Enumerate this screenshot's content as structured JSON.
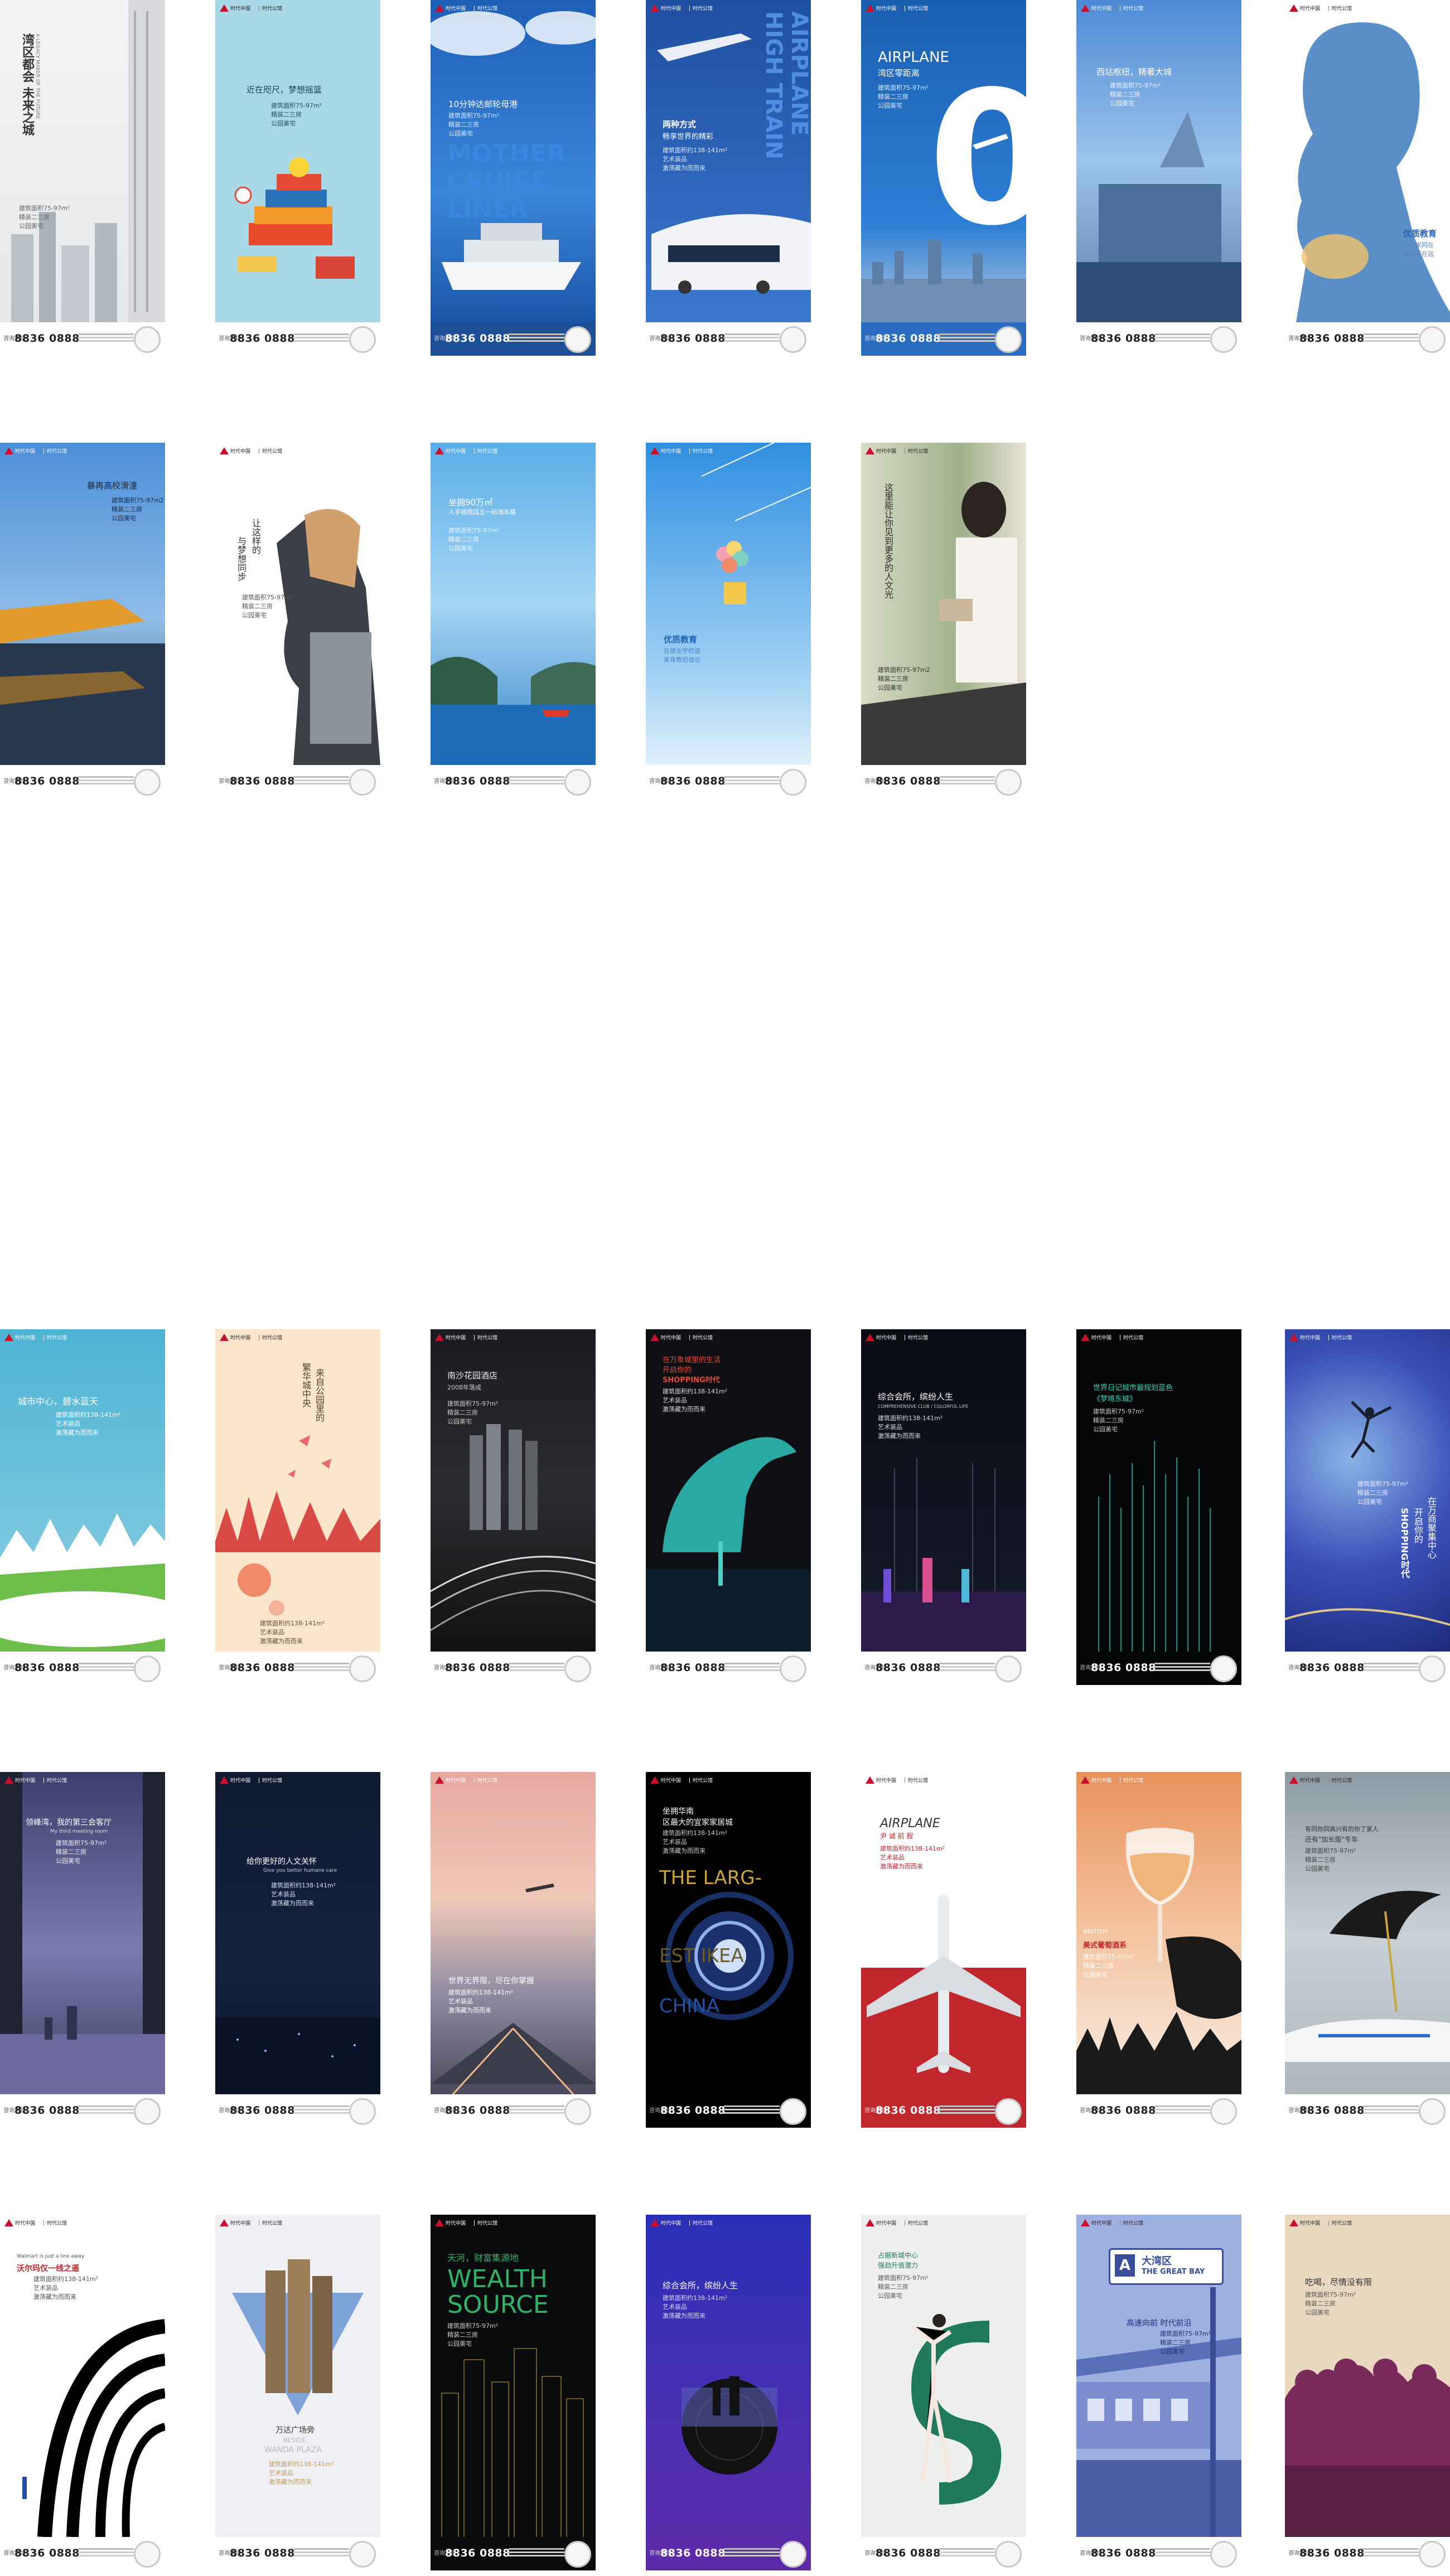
{
  "footer": {
    "phone_label": "咨询热线",
    "phone": "8836 0888"
  },
  "brand": {
    "name": "时代中国",
    "sub": "时代公馆"
  },
  "posters": [
    {
      "headline": "湾区都会 未来之城",
      "sub": "A LEGACY MAKER OF THE FUTURE",
      "lines": [
        "建筑面积75-97m²",
        "精装二三房",
        "公园美宅"
      ]
    },
    {
      "headline": "近在咫尺，梦想摇篮",
      "lines": [
        "建筑面积75-97m²",
        "精装二三房",
        "公园美宅"
      ]
    },
    {
      "headline": "10分钟达邮轮母港",
      "big": [
        "MOTHER",
        "CRUISE",
        "LINER"
      ],
      "lines": [
        "建筑面积75-97m²",
        "精装二三房",
        "公园美宅"
      ]
    },
    {
      "headline": "两种方式",
      "headline2": "畅享世界的精彩",
      "big": [
        "AIRPLANE",
        "HIGH TRAIN"
      ],
      "lines": [
        "建筑面积约138-141m²",
        "艺术装品",
        "激荡藏为而而来"
      ]
    },
    {
      "headline": "湾区零距离",
      "big": [
        "AIRPLANE",
        "0"
      ],
      "lines": [
        "建筑面积75-97m²",
        "精装二三房",
        "公园美宅"
      ]
    },
    {
      "headline": "西站枢纽，精著大城",
      "lines": [
        "建筑面积75-97m²",
        "精装二三房",
        "公园美宅"
      ]
    },
    {
      "headline": "优质教育",
      "lines": [
        "与众家同在",
        "教坊不在远"
      ]
    },
    {
      "headline": "暴再高校滑潼",
      "lines": [
        "建筑面积75-97m2",
        "精装二三房",
        "公园美宅"
      ]
    },
    {
      "headline": "与梦想同步",
      "headline2": "让这样的",
      "lines": [
        "建筑面积75-97m²",
        "精装二三房",
        "公园美宅"
      ]
    },
    {
      "headline": "坐拥90万㎡",
      "headline2": "人手插用园五一码海车路",
      "lines": [
        "建筑面积75-97m²",
        "精装二三房",
        "公园美宅"
      ]
    },
    {
      "headline": "优质教育",
      "lines": [
        "在建全学校道",
        "美育教观值也"
      ]
    },
    {
      "headline": "这里能让你见到更多的人文光",
      "lines": [
        "建筑面积75-97m2",
        "精装二三房",
        "公园美宅"
      ]
    },
    {
      "headline": "城市中心，碧水蓝天",
      "lines": [
        "建筑面积约138-141m²",
        "艺术装品",
        "激荡藏为而而来"
      ]
    },
    {
      "headline": "繁华城中央",
      "headline2": "来自公园里的",
      "lines": [
        "建筑面积约138-141m²",
        "艺术装品",
        "激荡藏为而而来"
      ]
    },
    {
      "headline": "南沙花园酒店",
      "sub": "2008年落成",
      "lines": [
        "建筑面积75-97m²",
        "精装二三房",
        "公园美宅"
      ]
    },
    {
      "headline": "在万象城里的生活",
      "headline2": "开启你的",
      "sub": "SHOPPING时代",
      "lines": [
        "建筑面积约138-141m²",
        "艺术装品",
        "激荡藏为而而来"
      ]
    },
    {
      "headline": "综合会所，缤纷人生",
      "sub": "COMPREHENSIVE CLUB / COLORFUL LIFE",
      "lines": [
        "建筑面积约138-141m²",
        "艺术装品",
        "激荡藏为而而来"
      ]
    },
    {
      "headline": "世界日记城市最规划蓝色",
      "headline2": "《梦境东城》",
      "lines": [
        "建筑面积75-97m²",
        "精装二三房",
        "公园美宅"
      ]
    },
    {
      "headline": "在万商聚集中心",
      "headline2": "开启你的",
      "sub": "SHOPPING时代",
      "lines": [
        "建筑面积75-97m²",
        "精装二三房",
        "公园美宅"
      ]
    },
    {
      "headline": "领峰湾，我的第三会客厅",
      "sub": "My third meeting room",
      "lines": [
        "建筑面积75-97m²",
        "精装二三房",
        "公园美宅"
      ]
    },
    {
      "headline": "给你更好的人文关怀",
      "sub": "Give you better humane care",
      "lines": [
        "建筑面积约138-141m²",
        "艺术装品",
        "激荡藏为而而来"
      ]
    },
    {
      "headline": "世界无界限，尽在你掌握",
      "lines": [
        "建筑面积约138-141m²",
        "艺术装品",
        "激荡藏为而而来"
      ]
    },
    {
      "headline": "坐拥华南",
      "headline2": "区最大的宜家家居城",
      "big": [
        "THE LARG-",
        "EST IKEA",
        "CHINA"
      ],
      "lines": [
        "建筑面积约138-141m²",
        "艺术装品",
        "激荡藏为而而来"
      ]
    },
    {
      "headline": "AIRPLANE",
      "headline2": "尹 诚 前 程",
      "lines": [
        "建筑面积约138-141m²",
        "艺术装品",
        "激荡藏为而而来"
      ]
    },
    {
      "headline": "美式葡萄酒系",
      "sub": "BRITISH",
      "lines": [
        "建筑面积75-97m²",
        "精装二三房",
        "公园美宅"
      ]
    },
    {
      "headline": "有同你同高兴有的你了家人",
      "headline2": "还有\"加长版\"专车",
      "lines": [
        "建筑面积75-97m²",
        "精装二三房",
        "公园美宅"
      ]
    },
    {
      "headline": "沃尔玛仅一线之遥",
      "sub": "Walmart is just a line away",
      "lines": [
        "建筑面积约138-141m²",
        "艺术装品",
        "激荡藏为而而来"
      ]
    },
    {
      "headline": "万达广场旁",
      "big": [
        "BESIDE",
        "WANDA PLAZA"
      ],
      "lines": [
        "建筑面积约138-141m²",
        "艺术装品",
        "激荡藏为而而来"
      ]
    },
    {
      "headline": "天河，财富集源地",
      "big": [
        "WEALTH",
        "SOURCE"
      ],
      "lines": [
        "建筑面积75-97m²",
        "精装二三房",
        "公园美宅"
      ]
    },
    {
      "headline": "综合会所，缤纷人生",
      "lines": [
        "建筑面积约138-141m²",
        "艺术装品",
        "激荡藏为而而来"
      ]
    },
    {
      "headline": "占据新城中心",
      "headline2": "强劲升值潜力",
      "lines": [
        "建筑面积75-97m²",
        "精装二三房",
        "公园美宅"
      ]
    },
    {
      "headline": "高速向前 时代前沿",
      "sign": [
        "A",
        "大湾区",
        "THE GREAT BAY"
      ],
      "lines": [
        "建筑面积75-97m²",
        "精装二三房",
        "公园美宅"
      ]
    },
    {
      "headline": "吃喝，尽情没有限",
      "lines": [
        "建筑面积75-97m²",
        "精装二三房",
        "公园美宅"
      ]
    }
  ]
}
